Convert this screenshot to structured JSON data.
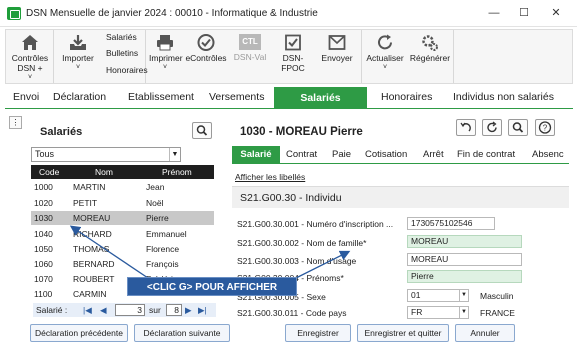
{
  "window": {
    "title": "DSN Mensuelle de janvier 2024 : 00010 - Informatique & Industrie",
    "minimize_glyph": "—",
    "maximize_glyph": "☐",
    "close_glyph": "✕"
  },
  "ribbon": {
    "controles_label": "Contrôles DSN +",
    "controles_sub": "˅",
    "importer_label": "Importer",
    "importer_sub": "˅",
    "salaries_label": "Salariés",
    "bulletins_label": "Bulletins",
    "honoraires_label": "Honoraires",
    "imprimer_label": "Imprimer",
    "imprimer_sub": "˅",
    "econtroles_label": "eContrôles",
    "dsnval_label": "DSN-Val",
    "dsnval_icon_text": "CTL",
    "dsnfpoc_label": "DSN-FPOC",
    "envoyer_label": "Envoyer",
    "actualiser_label": "Actualiser",
    "actualiser_sub": "˅",
    "regenerer_label": "Régénérer"
  },
  "tabs": [
    {
      "label": "Envoi"
    },
    {
      "label": "Déclaration"
    },
    {
      "label": "Etablissement"
    },
    {
      "label": "Versements"
    },
    {
      "label": "Salariés"
    },
    {
      "label": "Honoraires"
    },
    {
      "label": "Individus non salariés"
    }
  ],
  "left_panel": {
    "small_button": "⋮",
    "title": "Salariés",
    "filter_value": "Tous",
    "columns": [
      "Code",
      "Nom",
      "Prénom"
    ],
    "rows": [
      {
        "code": "1000",
        "nom": "MARTIN",
        "prenom": "Jean"
      },
      {
        "code": "1020",
        "nom": "PETIT",
        "prenom": "Noël"
      },
      {
        "code": "1030",
        "nom": "MOREAU",
        "prenom": "Pierre"
      },
      {
        "code": "1040",
        "nom": "RICHARD",
        "prenom": "Emmanuel"
      },
      {
        "code": "1050",
        "nom": "THOMAS",
        "prenom": "Florence"
      },
      {
        "code": "1060",
        "nom": "BERNARD",
        "prenom": "François"
      },
      {
        "code": "1070",
        "nom": "ROUBERT",
        "prenom": "Frédérique"
      },
      {
        "code": "1100",
        "nom": "CARMIN",
        "prenom": ""
      }
    ],
    "pager": {
      "label": "Salarié :",
      "first": "|◀",
      "prev": "◀",
      "current": "3",
      "sep": "sur",
      "total": "8",
      "next": "▶",
      "last": "▶|"
    }
  },
  "right_panel": {
    "title": "1030 - MOREAU Pierre",
    "subtabs": [
      "Salarié",
      "Contrat",
      "Paie",
      "Cotisation",
      "Arrêt",
      "Fin de contrat",
      "Absenc"
    ],
    "link": "Afficher les libellés",
    "section": "S21.G00.30 - Individu",
    "fields": [
      {
        "label": "S21.G00.30.001 - Numéro d'inscription ...",
        "value": "1730575102546",
        "extra": ""
      },
      {
        "label": "S21.G00.30.002 - Nom de famille*",
        "value": "MOREAU",
        "extra": ""
      },
      {
        "label": "S21.G00.30.003 - Nom d'usage",
        "value": "MOREAU",
        "extra": ""
      },
      {
        "label": "S21.G00.30.004 - Prénoms*",
        "value": "Pierre",
        "extra": ""
      },
      {
        "label": "S21.G00.30.005 - Sexe",
        "value": "01",
        "extra": "Masculin"
      },
      {
        "label": "S21.G00.30.011 - Code pays",
        "value": "FR",
        "extra": "FRANCE"
      }
    ]
  },
  "buttons": {
    "prev_decl": "Déclaration précédente",
    "next_decl": "Déclaration suivante",
    "save": "Enregistrer",
    "save_quit": "Enregistrer et quitter",
    "cancel": "Annuler"
  },
  "callout": {
    "text": "<CLIC G> POUR AFFICHER"
  },
  "colors": {
    "accent_green": "#2e9b45",
    "callout_blue": "#2a5a9e",
    "row_selected": "#c8c8c8"
  }
}
